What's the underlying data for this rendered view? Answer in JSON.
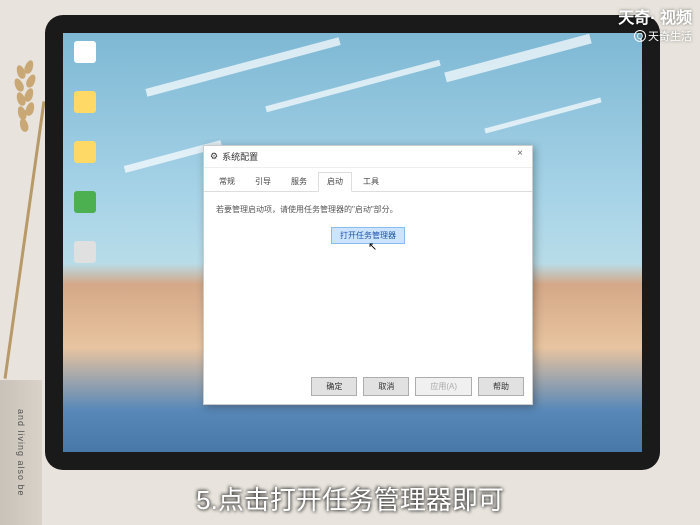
{
  "watermark": {
    "main": "天奇· 视频",
    "sub": "天奇生活"
  },
  "book_spine": "and living also be",
  "dialog": {
    "title": "系统配置",
    "tabs": [
      "常规",
      "引导",
      "服务",
      "启动",
      "工具"
    ],
    "active_tab_index": 3,
    "hint_text": "若要管理启动项，请使用任务管理器的\"启动\"部分。",
    "link_text": "打开任务管理器",
    "buttons": {
      "ok": "确定",
      "cancel": "取消",
      "apply": "应用(A)",
      "help": "帮助"
    }
  },
  "subtitle": "5.点击打开任务管理器即可"
}
